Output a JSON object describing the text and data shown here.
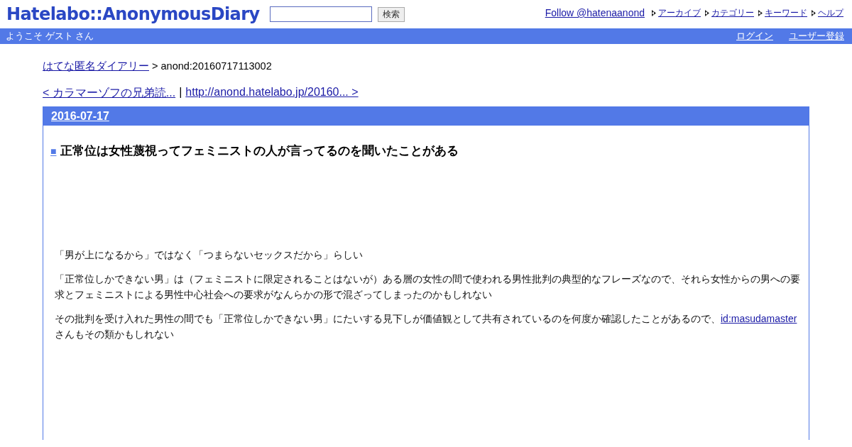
{
  "header": {
    "logo": "Hatelabo::AnonymousDiary",
    "search_button": "検索",
    "follow_link": "Follow @hatenaanond",
    "nav": [
      "アーカイブ",
      "カテゴリー",
      "キーワード",
      "ヘルプ"
    ]
  },
  "user_bar": {
    "welcome": "ようこそ ゲスト さん",
    "links": [
      "ログイン",
      "ユーザー登録"
    ]
  },
  "breadcrumb": {
    "link": "はてな匿名ダイアリー",
    "current": "> anond:20160717113002"
  },
  "pager": {
    "prev": "< カラマーゾフの兄弟読...",
    "separator": "|",
    "next": "http://anond.hatelabo.jp/20160... >"
  },
  "day": {
    "date": "2016-07-17",
    "entry": {
      "marker": "■",
      "title": "正常位は女性蔑視ってフェミニストの人が言ってるのを聞いたことがある",
      "paragraphs": [
        [
          {
            "kind": "text",
            "text": "「男が上になるから」ではなく「つまらないセックスだから」らしい"
          }
        ],
        [
          {
            "kind": "text",
            "text": "「正常位しかできない男」は（フェミニストに限定されることはないが）ある層の女性の間で使われる男性批判の典型的なフレーズなので、それら女性からの男への要求とフェミニストによる男性中心社会への要求がなんらかの形で混ざってしまったのかもしれない"
          }
        ],
        [
          {
            "kind": "text",
            "text": "その批判を受け入れた男性の間でも「正常位しかできない男」にたいする見下しが価値観として共有されているのを何度か確認したことがあるので、"
          },
          {
            "kind": "link",
            "text": "id:masudamaster"
          },
          {
            "kind": "text",
            "text": "さんもその類かもしれない"
          }
        ]
      ]
    }
  }
}
